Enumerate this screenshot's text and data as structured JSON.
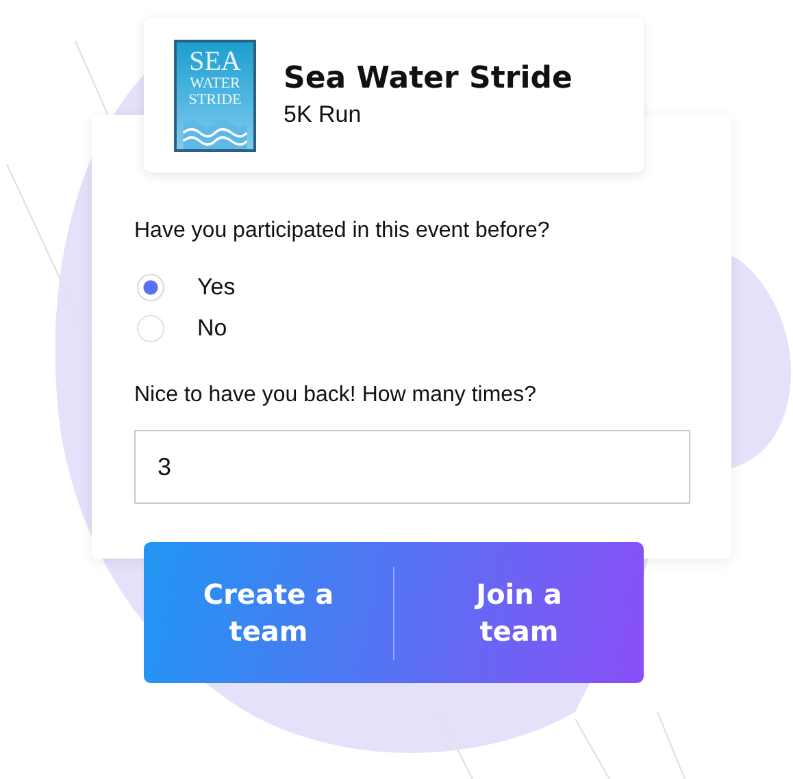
{
  "event": {
    "logo_lines": [
      "SEA",
      "WATER",
      "STRIDE"
    ],
    "title": "Sea Water Stride",
    "subtitle": "5K Run"
  },
  "question": "Have you participated in this event before?",
  "options": [
    {
      "label": "Yes",
      "selected": true
    },
    {
      "label": "No",
      "selected": false
    }
  ],
  "followup": {
    "label": "Nice to have you back! How many times?",
    "value": "3"
  },
  "buttons": [
    {
      "label": "Create a team"
    },
    {
      "label": "Join a team"
    }
  ]
}
